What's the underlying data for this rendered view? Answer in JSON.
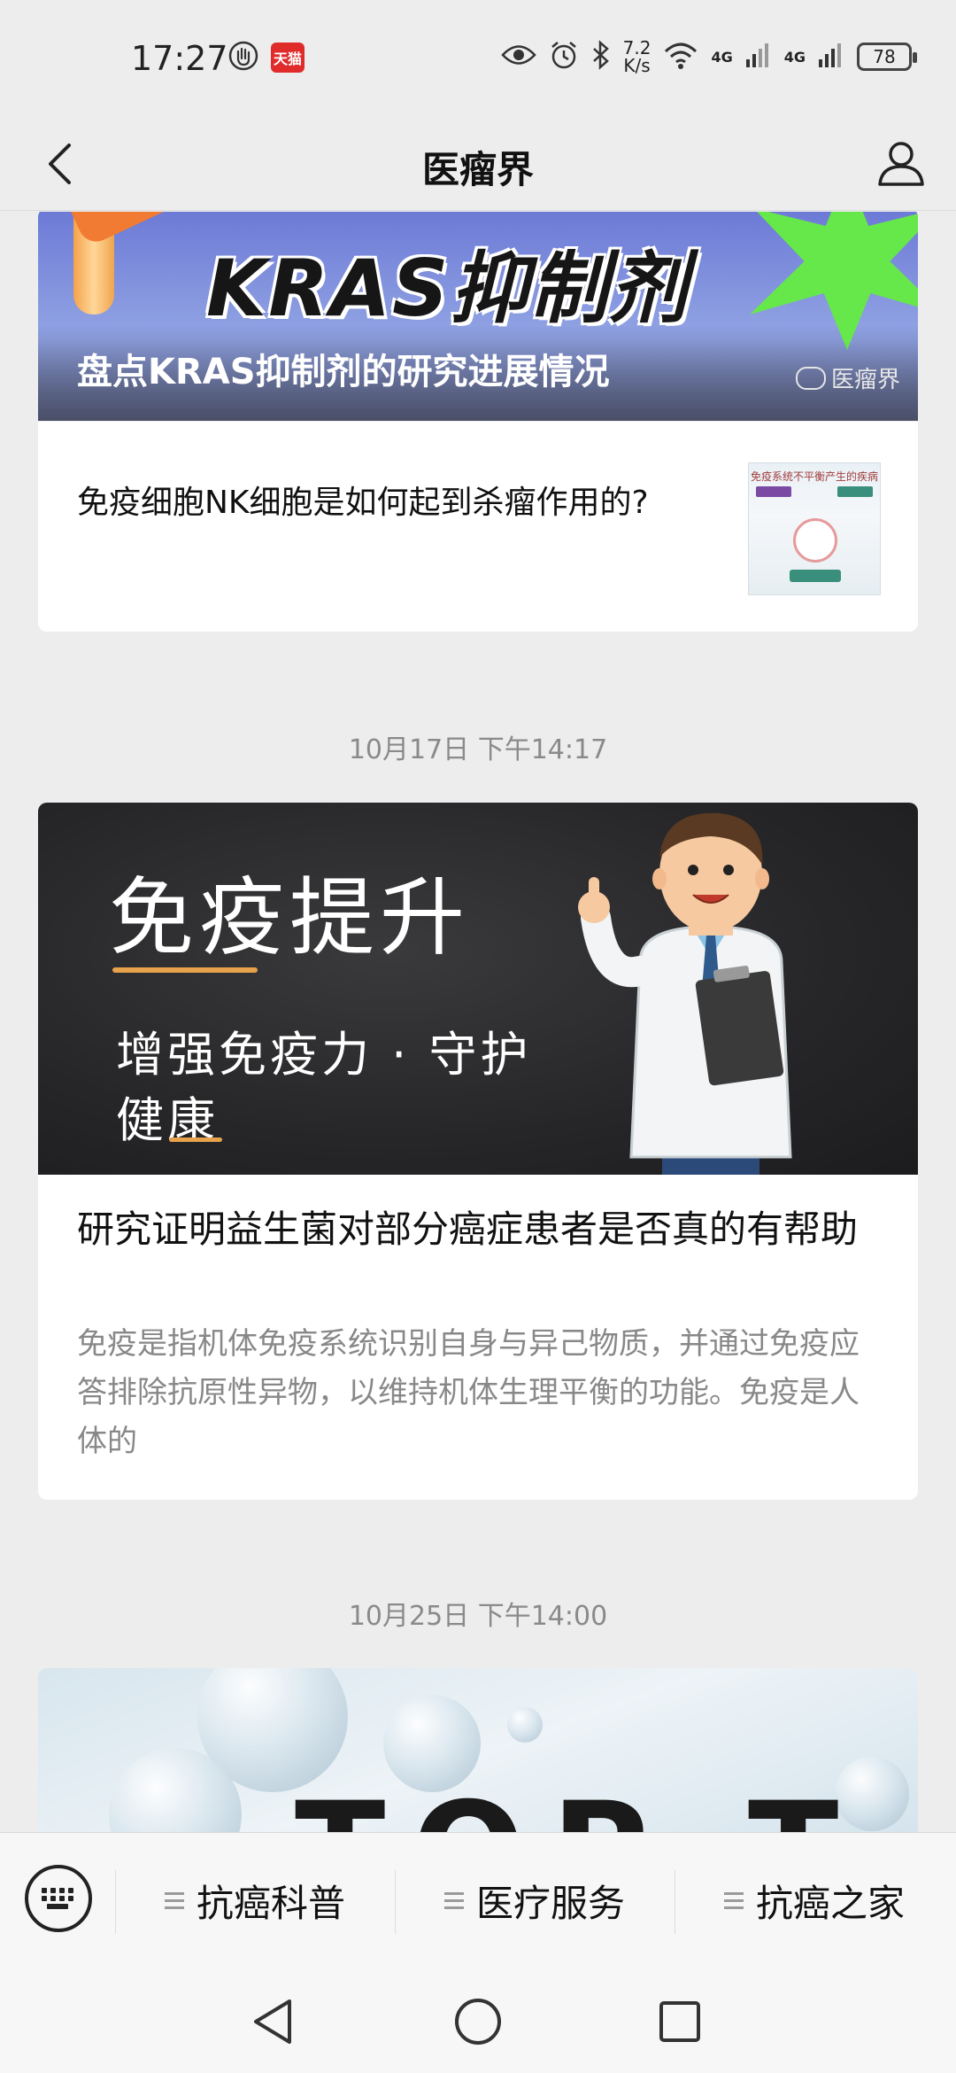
{
  "status_bar": {
    "time": "17:27",
    "tmall_label": "天猫",
    "speed_value": "7.2",
    "speed_unit": "K/s",
    "network1": "4G",
    "network2": "4G",
    "battery": "78"
  },
  "nav": {
    "title": "医瘤界"
  },
  "feed": {
    "card1": {
      "banner_title": "KRAS抑制剂",
      "banner_caption": "盘点KRAS抑制剂的研究进展情况",
      "watermark": "医瘤界",
      "sub_item_title": "免疫细胞NK细胞是如何起到杀瘤作用的?",
      "thumb_heading": "免疫系统不平衡产生的疾病"
    },
    "date1": "10月17日 下午14:17",
    "card2": {
      "banner_title": "免疫提升",
      "banner_sub1": "增强免疫力 · 守护",
      "banner_sub2": "健康",
      "title": "研究证明益生菌对部分癌症患者是否真的有帮助",
      "description": "免疫是指机体免疫系统识别自身与异己物质，并通过免疫应答排除抗原性异物，以维持机体生理平衡的功能。免疫是人体的"
    },
    "date2": "10月25日 下午14:00",
    "card3": {
      "banner_text": "TOP T"
    }
  },
  "bottom_menu": {
    "items": [
      {
        "label": "抗癌科普"
      },
      {
        "label": "医疗服务"
      },
      {
        "label": "抗癌之家"
      }
    ]
  },
  "colors": {
    "background": "#ededed",
    "accent_orange": "#e7a24b",
    "kras_green": "#66e84a",
    "tmall_red": "#e02b2b"
  }
}
